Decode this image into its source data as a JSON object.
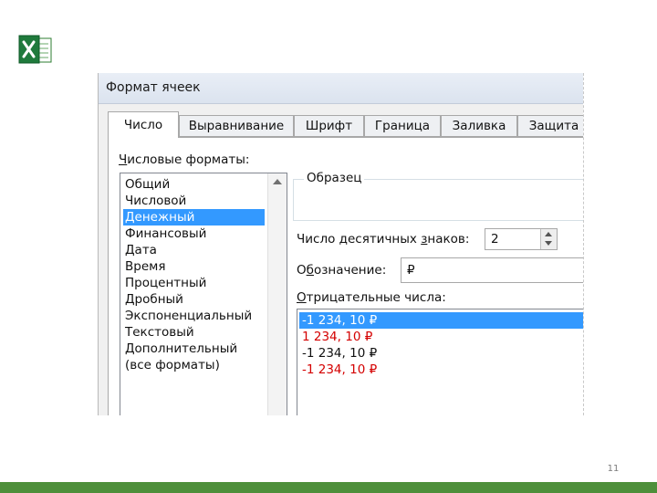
{
  "slide": {
    "page_number": "11"
  },
  "dialog": {
    "title": "Формат ячеек",
    "tabs": [
      "Число",
      "Выравнивание",
      "Шрифт",
      "Граница",
      "Заливка",
      "Защита"
    ],
    "number_formats": {
      "label_first": "Ч",
      "label_rest": "исловые форматы:",
      "items": [
        "Общий",
        "Числовой",
        "Денежный",
        "Финансовый",
        "Дата",
        "Время",
        "Процентный",
        "Дробный",
        "Экспоненциальный",
        "Текстовый",
        "Дополнительный",
        "(все форматы)"
      ],
      "selected": "Денежный"
    },
    "sample_label": "Образец",
    "decimals": {
      "label_a": "Число десятичных ",
      "label_u": "з",
      "label_b": "наков:",
      "value": "2"
    },
    "symbol": {
      "label_a": "О",
      "label_u": "б",
      "label_b": "означение:",
      "value": "₽"
    },
    "negatives": {
      "label_u": "О",
      "label_b": "трицательные числа:",
      "items": [
        {
          "text": "-1 234, 10 ₽",
          "color": "#ffffff"
        },
        {
          "text": "1 234, 10 ₽",
          "color": "#d40000"
        },
        {
          "text": "-1 234, 10 ₽",
          "color": "#111111"
        },
        {
          "text": "-1 234, 10 ₽",
          "color": "#d40000"
        }
      ]
    }
  },
  "colors": {
    "selection": "#3399ff",
    "brand_green": "#4e8f3a",
    "excel_green": "#1f7a3c"
  },
  "icons": {
    "app_logo": "excel-icon"
  }
}
